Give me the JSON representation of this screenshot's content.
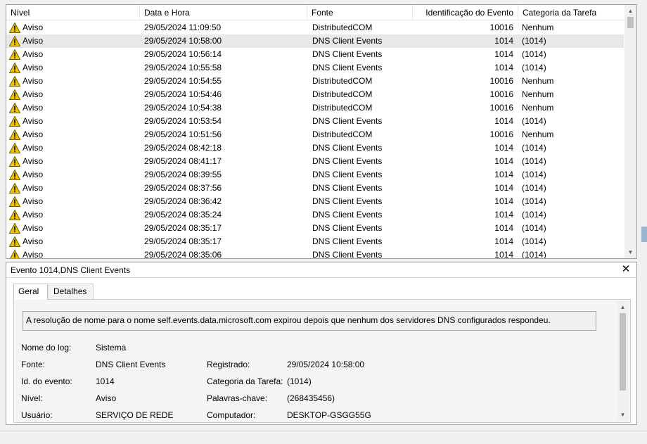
{
  "columns": {
    "nivel": "Nível",
    "data_hora": "Data e Hora",
    "fonte": "Fonte",
    "id_evento": "Identificação do Evento",
    "categoria": "Categoria da Tarefa"
  },
  "rows": [
    {
      "nivel": "Aviso",
      "data_hora": "29/05/2024 11:09:50",
      "fonte": "DistributedCOM",
      "id": "10016",
      "categoria": "Nenhum"
    },
    {
      "nivel": "Aviso",
      "data_hora": "29/05/2024 10:58:00",
      "fonte": "DNS Client Events",
      "id": "1014",
      "categoria": "(1014)"
    },
    {
      "nivel": "Aviso",
      "data_hora": "29/05/2024 10:56:14",
      "fonte": "DNS Client Events",
      "id": "1014",
      "categoria": "(1014)"
    },
    {
      "nivel": "Aviso",
      "data_hora": "29/05/2024 10:55:58",
      "fonte": "DNS Client Events",
      "id": "1014",
      "categoria": "(1014)"
    },
    {
      "nivel": "Aviso",
      "data_hora": "29/05/2024 10:54:55",
      "fonte": "DistributedCOM",
      "id": "10016",
      "categoria": "Nenhum"
    },
    {
      "nivel": "Aviso",
      "data_hora": "29/05/2024 10:54:46",
      "fonte": "DistributedCOM",
      "id": "10016",
      "categoria": "Nenhum"
    },
    {
      "nivel": "Aviso",
      "data_hora": "29/05/2024 10:54:38",
      "fonte": "DistributedCOM",
      "id": "10016",
      "categoria": "Nenhum"
    },
    {
      "nivel": "Aviso",
      "data_hora": "29/05/2024 10:53:54",
      "fonte": "DNS Client Events",
      "id": "1014",
      "categoria": "(1014)"
    },
    {
      "nivel": "Aviso",
      "data_hora": "29/05/2024 10:51:56",
      "fonte": "DistributedCOM",
      "id": "10016",
      "categoria": "Nenhum"
    },
    {
      "nivel": "Aviso",
      "data_hora": "29/05/2024 08:42:18",
      "fonte": "DNS Client Events",
      "id": "1014",
      "categoria": "(1014)"
    },
    {
      "nivel": "Aviso",
      "data_hora": "29/05/2024 08:41:17",
      "fonte": "DNS Client Events",
      "id": "1014",
      "categoria": "(1014)"
    },
    {
      "nivel": "Aviso",
      "data_hora": "29/05/2024 08:39:55",
      "fonte": "DNS Client Events",
      "id": "1014",
      "categoria": "(1014)"
    },
    {
      "nivel": "Aviso",
      "data_hora": "29/05/2024 08:37:56",
      "fonte": "DNS Client Events",
      "id": "1014",
      "categoria": "(1014)"
    },
    {
      "nivel": "Aviso",
      "data_hora": "29/05/2024 08:36:42",
      "fonte": "DNS Client Events",
      "id": "1014",
      "categoria": "(1014)"
    },
    {
      "nivel": "Aviso",
      "data_hora": "29/05/2024 08:35:24",
      "fonte": "DNS Client Events",
      "id": "1014",
      "categoria": "(1014)"
    },
    {
      "nivel": "Aviso",
      "data_hora": "29/05/2024 08:35:17",
      "fonte": "DNS Client Events",
      "id": "1014",
      "categoria": "(1014)"
    },
    {
      "nivel": "Aviso",
      "data_hora": "29/05/2024 08:35:17",
      "fonte": "DNS Client Events",
      "id": "1014",
      "categoria": "(1014)"
    },
    {
      "nivel": "Aviso",
      "data_hora": "29/05/2024 08:35:06",
      "fonte": "DNS Client Events",
      "id": "1014",
      "categoria": "(1014)"
    }
  ],
  "selected_row": 1,
  "detail": {
    "title": "Evento 1014,DNS Client Events",
    "tabs": [
      "Geral",
      "Detalhes"
    ],
    "active_tab": 0,
    "description": "A resolução de nome para o nome self.events.data.microsoft.com expirou depois que nenhum dos servidores DNS configurados respondeu.",
    "labels": {
      "nome_log": "Nome do log:",
      "fonte": "Fonte:",
      "id_evento": "Id. do evento:",
      "nivel": "Nível:",
      "usuario": "Usuário:",
      "registrado": "Registrado:",
      "categoria": "Categoria da Tarefa:",
      "palavras": "Palavras-chave:",
      "computador": "Computador:"
    },
    "values": {
      "nome_log": "Sistema",
      "fonte": "DNS Client Events",
      "id_evento": "1014",
      "nivel": "Aviso",
      "usuario": "SERVIÇO DE REDE",
      "registrado": "29/05/2024 10:58:00",
      "categoria": "(1014)",
      "palavras": "(268435456)",
      "computador": "DESKTOP-GSGG55G"
    }
  },
  "icons": {
    "warning": "warning-icon",
    "close": "close-icon",
    "scroll_up": "chevron-up-icon",
    "scroll_down": "chevron-down-icon"
  },
  "colors": {
    "selected_row": "#e8e8e8",
    "warning_yellow": "#f5c400"
  }
}
